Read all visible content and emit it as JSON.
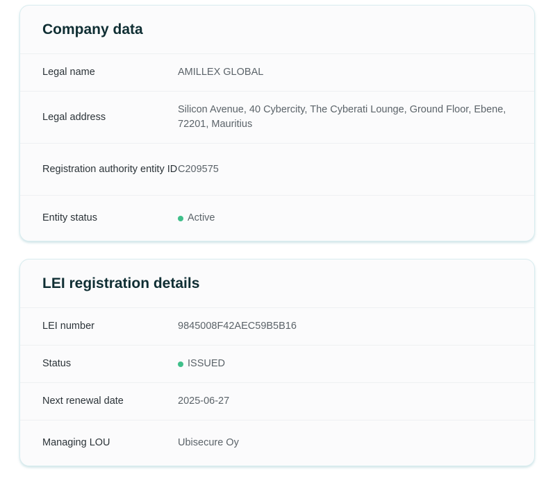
{
  "company": {
    "title": "Company data",
    "rows": [
      {
        "label": "Legal name",
        "value": "AMILLEX GLOBAL"
      },
      {
        "label": "Legal address",
        "value": "Silicon Avenue, 40 Cybercity, The Cyberati Lounge, Ground Floor, Ebene, 72201, Mauritius"
      },
      {
        "label": "Registration authority entity ID",
        "value": "C209575"
      },
      {
        "label": "Entity status",
        "value": "Active"
      }
    ]
  },
  "lei": {
    "title": "LEI registration details",
    "rows": [
      {
        "label": "LEI number",
        "value": "9845008F42AEC59B5B16"
      },
      {
        "label": "Status",
        "value": "ISSUED"
      },
      {
        "label": "Next renewal date",
        "value": "2025-06-27"
      },
      {
        "label": "Managing LOU",
        "value": "Ubisecure Oy"
      }
    ]
  },
  "colors": {
    "status_active": "#3fbf8a",
    "status_issued": "#3fbf8a"
  },
  "icons": {
    "status_indicator": "status-dot-icon"
  }
}
